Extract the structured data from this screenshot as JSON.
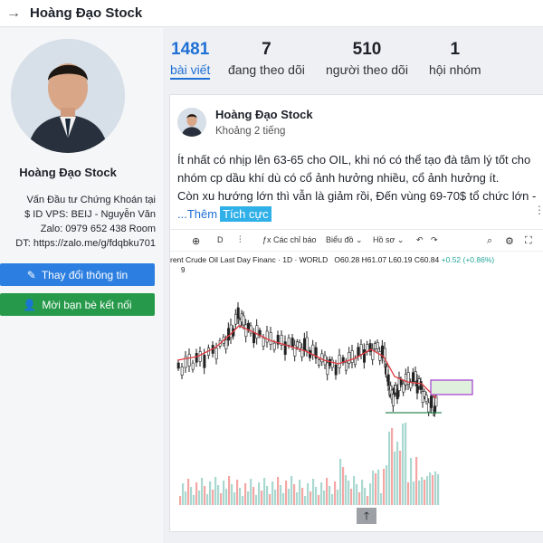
{
  "header": {
    "title": "Hoàng Đạo Stock",
    "back_icon": "arrow-left-icon"
  },
  "profile": {
    "name": "Hoàng Đạo Stock",
    "bio_lines": [
      "Vấn Đầu tư Chứng Khoán tại",
      "$ ID VPS: BEIJ - Nguyễn Văn",
      "Zalo: 0979 652 438 Room",
      "DT: https://zalo.me/g/fdqbku701"
    ],
    "edit_button": "Thay đổi thông tin",
    "invite_button": "Mời bạn bè kết nối"
  },
  "stats": [
    {
      "value": "1481",
      "label": "bài viết",
      "active": true
    },
    {
      "value": "7",
      "label": "đang theo dõi"
    },
    {
      "value": "510",
      "label": "người theo dõi"
    },
    {
      "value": "1",
      "label": "hội nhóm"
    }
  ],
  "post": {
    "author": "Hoàng Đạo Stock",
    "time": "Khoảng 2 tiếng",
    "text_lines": [
      "Ít nhất có nhịp lên 63-65 cho OIL, khi nó có thể tạo đà tâm lý tốt cho",
      "nhóm cp dầu khí dù có cổ ảnh hưởng nhiều, cổ ảnh hưởng ít.",
      "Còn xu hướng lớn thì vẫn là giảm rồi, Đến vùng 69-70$ tổ chức lớn -"
    ],
    "more": "...Thêm",
    "tag": "Tích cực"
  },
  "chart_toolbar": {
    "interval": "D",
    "indicators": "Các chỉ báo",
    "chart_type": "Biểu đồ",
    "profile": "Hồ sơ"
  },
  "chart_legend": {
    "symbol": "rent Crude Oil Last Day Financ · 1D · WORLD",
    "o": "O60.28",
    "h": "H61.07",
    "l": "L60.19",
    "c": "C60.84",
    "chg": "+0.52 (+0.86%)",
    "tick": "9"
  },
  "colors": {
    "accent": "#1e6fd6",
    "up": "#26a69a",
    "down": "#ef5350",
    "ma": "#e0383e"
  }
}
